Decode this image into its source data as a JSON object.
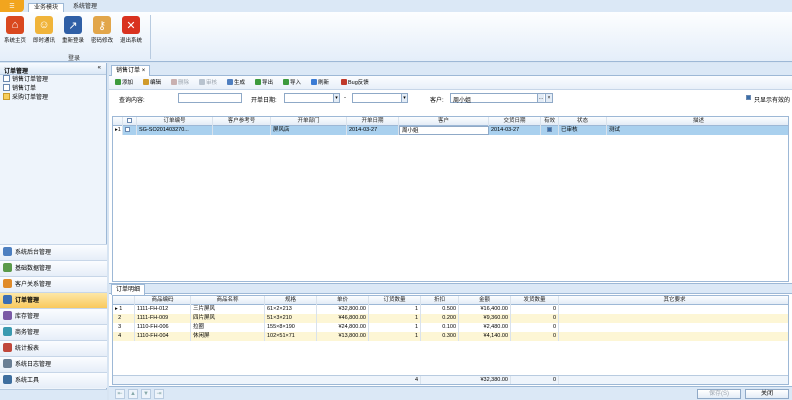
{
  "ribbon": {
    "tabs": [
      "业务模块",
      "系统管理"
    ],
    "buttons": [
      "系统主页",
      "即时通讯",
      "重新登录",
      "密码修改",
      "退出系统"
    ],
    "group_label": "登录"
  },
  "left_panel": {
    "title": "订单管理",
    "items": [
      "销售订单管理",
      "销售订单",
      "采购订单管理"
    ],
    "nav": [
      "系统后台管理",
      "基础数据管理",
      "客户关系管理",
      "订单管理",
      "库存管理",
      "商务管理",
      "统计报表",
      "系统日志管理",
      "系统工具"
    ]
  },
  "doc_tab": "销售订单",
  "toolbar": [
    {
      "label": "添加",
      "disabled": false
    },
    {
      "label": "编辑",
      "disabled": false
    },
    {
      "label": "删除",
      "disabled": true
    },
    {
      "label": "审核",
      "disabled": true
    },
    {
      "label": "生成",
      "disabled": false
    },
    {
      "label": "导出",
      "disabled": false
    },
    {
      "label": "导入",
      "disabled": false
    },
    {
      "label": "刷新",
      "disabled": false
    },
    {
      "label": "Bug反馈",
      "disabled": false
    }
  ],
  "filter": {
    "query_label": "查询内容:",
    "date_label": "开单日期:",
    "dash": "-",
    "customer_label": "客户:",
    "customer_value": "周小姐",
    "only_valid_label": "只显示有效的"
  },
  "orders": {
    "columns": [
      "订单编号",
      "客户参考号",
      "开单部门",
      "开单日期",
      "客户",
      "交货日期",
      "有效",
      "状态",
      "描述"
    ],
    "rows": [
      {
        "index": "1",
        "order_no": "SG-SO201403270...",
        "ref": "",
        "dept": "屏风店",
        "date": "2014-03-27",
        "customer": "周小姐",
        "delivery": "2014-03-27",
        "valid": true,
        "status": "已审核",
        "desc": "测试"
      }
    ]
  },
  "detail_tab": "订单明细",
  "details": {
    "columns": [
      "商品编码",
      "商品名称",
      "规格",
      "单价",
      "订货数量",
      "折扣",
      "金额",
      "发货数量",
      "其它要求"
    ],
    "rows": [
      {
        "index": "1",
        "code": "1111-FH-012",
        "name": "三片屏风",
        "spec": "61×2×213",
        "price": "¥32,800.00",
        "qty": "1",
        "discount": "0.500",
        "amount": "¥16,400.00",
        "shipped": "0",
        "other": ""
      },
      {
        "index": "2",
        "code": "1111-FH-009",
        "name": "四片屏风",
        "spec": "51×3×210",
        "price": "¥46,800.00",
        "qty": "1",
        "discount": "0.200",
        "amount": "¥9,360.00",
        "shipped": "0",
        "other": ""
      },
      {
        "index": "3",
        "code": "1110-FH-006",
        "name": "拉圈",
        "spec": "155×8×190",
        "price": "¥24,800.00",
        "qty": "1",
        "discount": "0.100",
        "amount": "¥2,480.00",
        "shipped": "0",
        "other": ""
      },
      {
        "index": "4",
        "code": "1110-FH-004",
        "name": "休闲屏",
        "spec": "102×51×71",
        "price": "¥13,800.00",
        "qty": "1",
        "discount": "0.300",
        "amount": "¥4,140.00",
        "shipped": "0",
        "other": ""
      }
    ],
    "totals": {
      "qty": "4",
      "amount": "¥32,380.00",
      "shipped": "0"
    }
  },
  "footer": {
    "save_label": "保存(S)",
    "close_label": "关闭"
  },
  "colors": {
    "selected_row": "#a9d0ee",
    "alt_row": "#fdf6d5",
    "accent": "#f9c95d"
  }
}
